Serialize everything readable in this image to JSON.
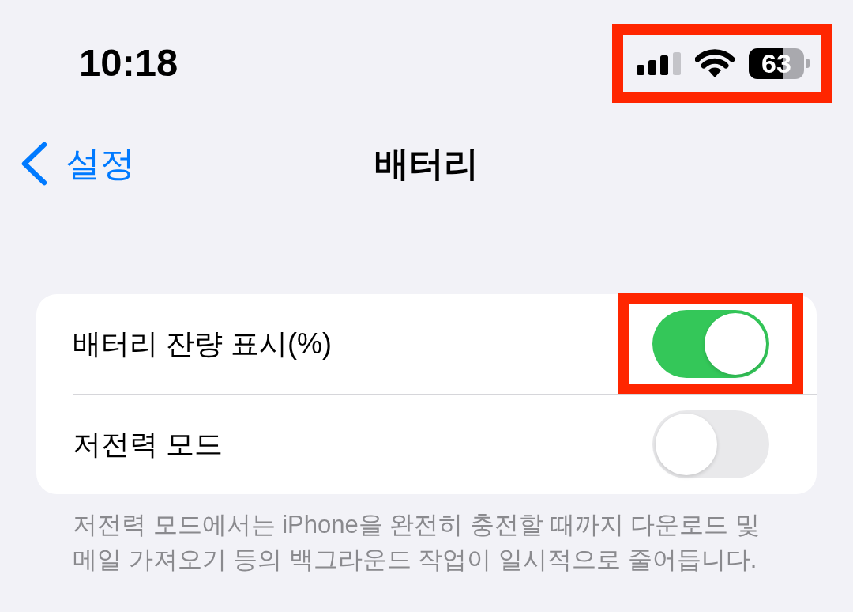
{
  "status_bar": {
    "time": "10:18",
    "highlighted": true,
    "battery": {
      "label": "63",
      "level": 0.63
    }
  },
  "nav": {
    "back_label": "설정",
    "title": "배터리"
  },
  "settings": [
    {
      "label": "배터리 잔량 표시(%)",
      "on": true,
      "highlighted": true
    },
    {
      "label": "저전력 모드",
      "on": false,
      "highlighted": false
    }
  ],
  "footer": "저전력 모드에서는 iPhone을 완전히 충전할 때까지 다운로드 및 메일 가져오기 등의 백그라운드 작업이 일시적으로 줄어듭니다."
}
